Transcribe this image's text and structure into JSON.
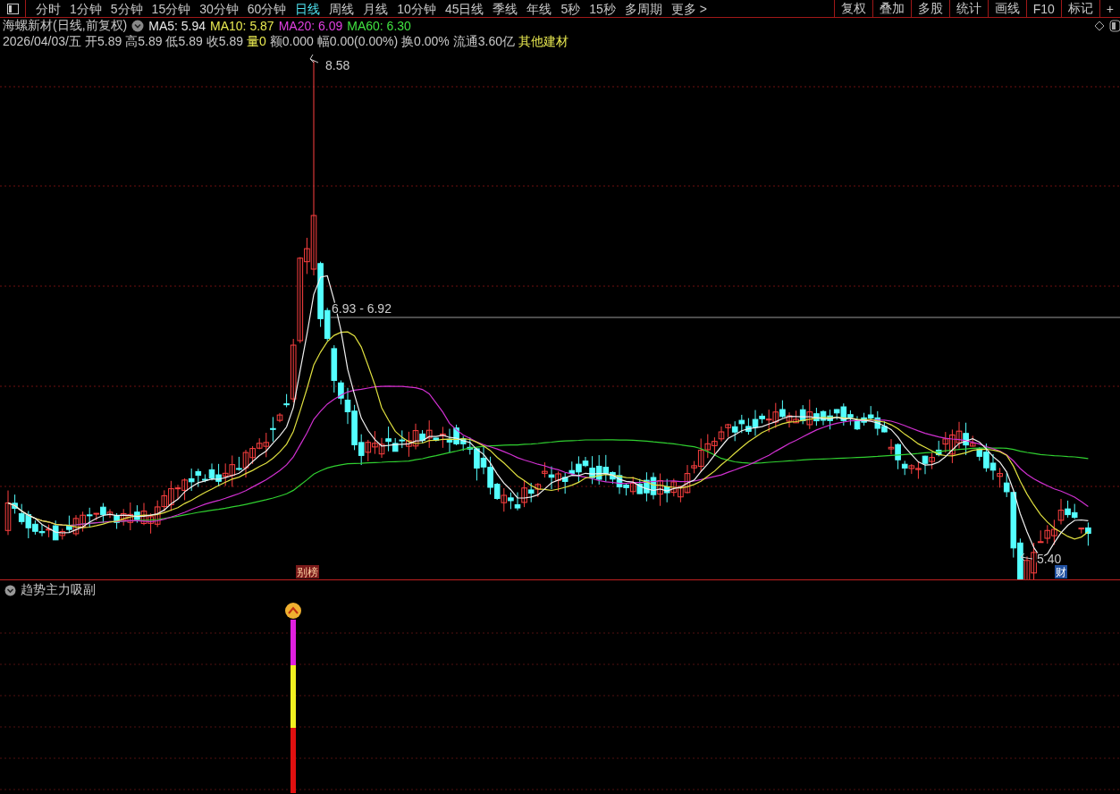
{
  "toolbar": {
    "periods": [
      {
        "label": "分时",
        "selected": false
      },
      {
        "label": "1分钟",
        "selected": false
      },
      {
        "label": "5分钟",
        "selected": false
      },
      {
        "label": "15分钟",
        "selected": false
      },
      {
        "label": "30分钟",
        "selected": false
      },
      {
        "label": "60分钟",
        "selected": false
      },
      {
        "label": "日线",
        "selected": true
      },
      {
        "label": "周线",
        "selected": false
      },
      {
        "label": "月线",
        "selected": false
      },
      {
        "label": "10分钟",
        "selected": false
      },
      {
        "label": "45日线",
        "selected": false
      },
      {
        "label": "季线",
        "selected": false
      },
      {
        "label": "年线",
        "selected": false
      },
      {
        "label": "5秒",
        "selected": false
      },
      {
        "label": "15秒",
        "selected": false
      },
      {
        "label": "多周期",
        "selected": false
      },
      {
        "label": "更多 >",
        "selected": false
      }
    ],
    "tools": [
      "复权",
      "叠加",
      "多股",
      "统计",
      "画线",
      "F10",
      "标记",
      "+"
    ]
  },
  "header": {
    "title": "海螺新材(日线,前复权)",
    "moving_averages": [
      {
        "label": "MA5: 5.94",
        "color": "#e8e8e8"
      },
      {
        "label": "MA10: 5.87",
        "color": "#e8e850"
      },
      {
        "label": "MA20: 6.09",
        "color": "#e040e0"
      },
      {
        "label": "MA60: 6.30",
        "color": "#40e040"
      }
    ],
    "quote": [
      {
        "text": "2026/04/03/五",
        "color": "#c8c8c8"
      },
      {
        "text": "开5.89",
        "color": "#c8c8c8"
      },
      {
        "text": "高5.89",
        "color": "#c8c8c8"
      },
      {
        "text": "低5.89",
        "color": "#c8c8c8"
      },
      {
        "text": "收5.89",
        "color": "#c8c8c8"
      },
      {
        "text": "量0",
        "color": "#e8e850"
      },
      {
        "text": "额0.000",
        "color": "#c8c8c8"
      },
      {
        "text": "幅0.00(0.00%)",
        "color": "#c8c8c8"
      },
      {
        "text": "换0.00%",
        "color": "#c8c8c8"
      },
      {
        "text": "流通3.60亿",
        "color": "#c8c8c8"
      },
      {
        "text": "其他建材",
        "color": "#e8e850"
      }
    ]
  },
  "chart": {
    "high_label": "8.58",
    "range_label": "6.93 - 6.92",
    "low_label": "5.40",
    "markers": [
      {
        "text": "别榜",
        "kind": "dragon"
      },
      {
        "text": "财",
        "kind": "finance"
      }
    ]
  },
  "indicator": {
    "title": "趋势主力吸副"
  }
}
